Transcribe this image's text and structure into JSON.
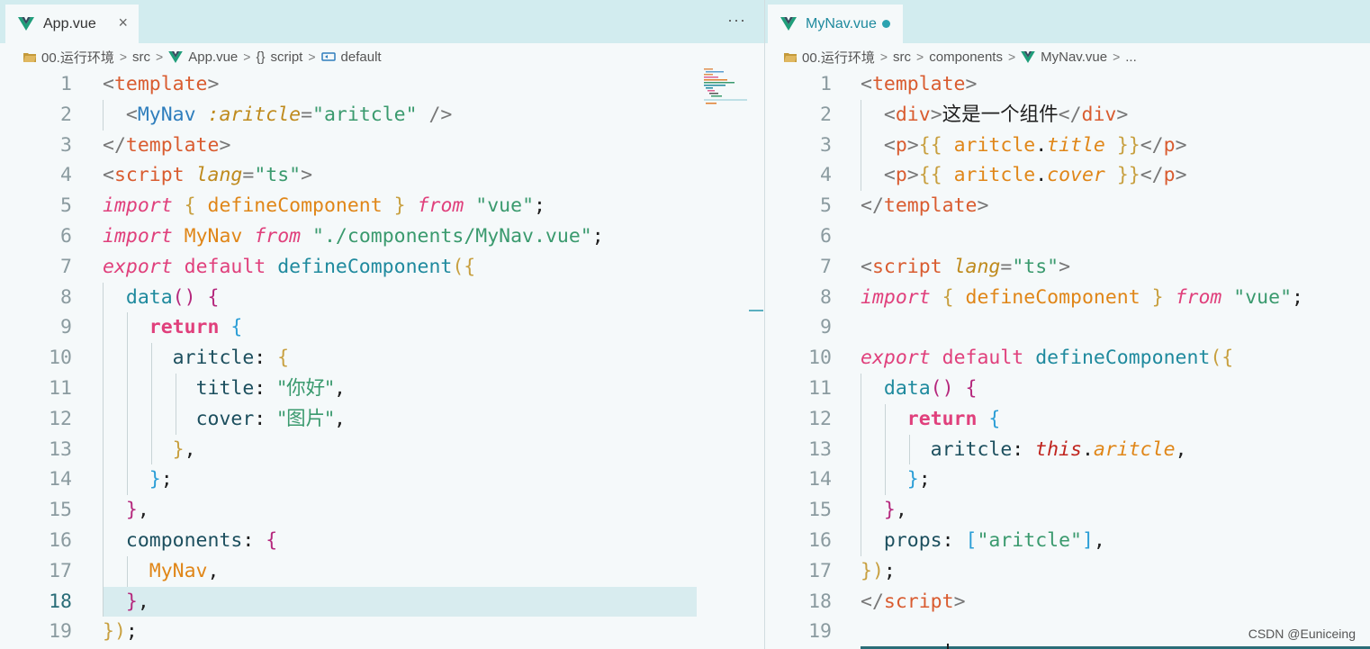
{
  "left": {
    "tab": {
      "name": "App.vue",
      "close": "×",
      "more": "···"
    },
    "breadcrumb": [
      "00.运行环境",
      "src",
      "App.vue",
      "script",
      "default"
    ],
    "line_numbers": [
      "1",
      "2",
      "3",
      "4",
      "5",
      "6",
      "7",
      "8",
      "9",
      "10",
      "11",
      "12",
      "13",
      "14",
      "15",
      "16",
      "17",
      "18",
      "19"
    ],
    "current_line": "18"
  },
  "right": {
    "tab": {
      "name": "MyNav.vue"
    },
    "breadcrumb": [
      "00.运行环境",
      "src",
      "components",
      "MyNav.vue",
      "..."
    ],
    "line_numbers": [
      "1",
      "2",
      "3",
      "4",
      "5",
      "6",
      "7",
      "8",
      "9",
      "10",
      "11",
      "12",
      "13",
      "14",
      "15",
      "16",
      "17",
      "18",
      "19"
    ]
  },
  "code_left": [
    [
      [
        "pu",
        "<"
      ],
      [
        "tg",
        "template"
      ],
      [
        "pu",
        ">"
      ]
    ],
    [
      [
        "pu",
        "  <"
      ],
      [
        "cm",
        "MyNav"
      ],
      [
        "bk",
        " "
      ],
      [
        "at",
        ":aritcle"
      ],
      [
        "pu",
        "="
      ],
      [
        "st",
        "\"aritcle\""
      ],
      [
        "pu",
        " />"
      ]
    ],
    [
      [
        "pu",
        "</"
      ],
      [
        "tg",
        "template"
      ],
      [
        "pu",
        ">"
      ]
    ],
    [
      [
        "pu",
        "<"
      ],
      [
        "tg",
        "script"
      ],
      [
        "bk",
        " "
      ],
      [
        "at",
        "lang"
      ],
      [
        "pu",
        "="
      ],
      [
        "st",
        "\"ts\""
      ],
      [
        "pu",
        ">"
      ]
    ],
    [
      [
        "kw",
        "import"
      ],
      [
        "bk",
        " "
      ],
      [
        "br1",
        "{"
      ],
      [
        "bk",
        " "
      ],
      [
        "cl",
        "defineComponent"
      ],
      [
        "bk",
        " "
      ],
      [
        "br1",
        "}"
      ],
      [
        "bk",
        " "
      ],
      [
        "kw",
        "from"
      ],
      [
        "bk",
        " "
      ],
      [
        "st",
        "\"vue\""
      ],
      [
        "bk",
        ";"
      ]
    ],
    [
      [
        "kw",
        "import"
      ],
      [
        "bk",
        " "
      ],
      [
        "cl",
        "MyNav"
      ],
      [
        "bk",
        " "
      ],
      [
        "kw",
        "from"
      ],
      [
        "bk",
        " "
      ],
      [
        "st",
        "\"./components/MyNav.vue\""
      ],
      [
        "bk",
        ";"
      ]
    ],
    [
      [
        "kw",
        "export"
      ],
      [
        "bk",
        " "
      ],
      [
        "ke",
        "default"
      ],
      [
        "bk",
        " "
      ],
      [
        "fn",
        "defineComponent"
      ],
      [
        "br1",
        "({"
      ]
    ],
    [
      [
        "bk",
        "  "
      ],
      [
        "fn",
        "data"
      ],
      [
        "br2",
        "()"
      ],
      [
        "bk",
        " "
      ],
      [
        "br2",
        "{"
      ]
    ],
    [
      [
        "bk",
        "    "
      ],
      [
        "kb",
        "return"
      ],
      [
        "bk",
        " "
      ],
      [
        "br3",
        "{"
      ]
    ],
    [
      [
        "bk",
        "      "
      ],
      [
        "id",
        "aritcle"
      ],
      [
        "bk",
        ": "
      ],
      [
        "br1",
        "{"
      ]
    ],
    [
      [
        "bk",
        "        "
      ],
      [
        "id",
        "title"
      ],
      [
        "bk",
        ": "
      ],
      [
        "st",
        "\"你好\""
      ],
      [
        "bk",
        ","
      ]
    ],
    [
      [
        "bk",
        "        "
      ],
      [
        "id",
        "cover"
      ],
      [
        "bk",
        ": "
      ],
      [
        "st",
        "\"图片\""
      ],
      [
        "bk",
        ","
      ]
    ],
    [
      [
        "bk",
        "      "
      ],
      [
        "br1",
        "}"
      ],
      [
        "bk",
        ","
      ]
    ],
    [
      [
        "bk",
        "    "
      ],
      [
        "br3",
        "}"
      ],
      [
        "bk",
        ";"
      ]
    ],
    [
      [
        "bk",
        "  "
      ],
      [
        "br2",
        "}"
      ],
      [
        "bk",
        ","
      ]
    ],
    [
      [
        "bk",
        "  "
      ],
      [
        "id",
        "components"
      ],
      [
        "bk",
        ": "
      ],
      [
        "br2",
        "{"
      ]
    ],
    [
      [
        "bk",
        "    "
      ],
      [
        "cl",
        "MyNav"
      ],
      [
        "bk",
        ","
      ]
    ],
    [
      [
        "bk",
        "  "
      ],
      [
        "br2",
        "}"
      ],
      [
        "bk",
        ","
      ]
    ],
    [
      [
        "br1",
        "})"
      ],
      [
        "bk",
        ";"
      ]
    ]
  ],
  "code_right": [
    [
      [
        "pu",
        "<"
      ],
      [
        "tg",
        "template"
      ],
      [
        "pu",
        ">"
      ]
    ],
    [
      [
        "pu",
        "  <"
      ],
      [
        "tg",
        "div"
      ],
      [
        "pu",
        ">"
      ],
      [
        "bk",
        "这是一个组件"
      ],
      [
        "pu",
        "</"
      ],
      [
        "tg",
        "div"
      ],
      [
        "pu",
        ">"
      ]
    ],
    [
      [
        "pu",
        "  <"
      ],
      [
        "tg",
        "p"
      ],
      [
        "pu",
        ">"
      ],
      [
        "br1",
        "{{"
      ],
      [
        "bk",
        " "
      ],
      [
        "cl",
        "aritcle"
      ],
      [
        "bk",
        "."
      ],
      [
        "pr",
        "title"
      ],
      [
        "bk",
        " "
      ],
      [
        "br1",
        "}}"
      ],
      [
        "pu",
        "</"
      ],
      [
        "tg",
        "p"
      ],
      [
        "pu",
        ">"
      ]
    ],
    [
      [
        "pu",
        "  <"
      ],
      [
        "tg",
        "p"
      ],
      [
        "pu",
        ">"
      ],
      [
        "br1",
        "{{"
      ],
      [
        "bk",
        " "
      ],
      [
        "cl",
        "aritcle"
      ],
      [
        "bk",
        "."
      ],
      [
        "pr",
        "cover"
      ],
      [
        "bk",
        " "
      ],
      [
        "br1",
        "}}"
      ],
      [
        "pu",
        "</"
      ],
      [
        "tg",
        "p"
      ],
      [
        "pu",
        ">"
      ]
    ],
    [
      [
        "pu",
        "</"
      ],
      [
        "tg",
        "template"
      ],
      [
        "pu",
        ">"
      ]
    ],
    [],
    [
      [
        "pu",
        "<"
      ],
      [
        "tg",
        "script"
      ],
      [
        "bk",
        " "
      ],
      [
        "at",
        "lang"
      ],
      [
        "pu",
        "="
      ],
      [
        "st",
        "\"ts\""
      ],
      [
        "pu",
        ">"
      ]
    ],
    [
      [
        "kw",
        "import"
      ],
      [
        "bk",
        " "
      ],
      [
        "br1",
        "{"
      ],
      [
        "bk",
        " "
      ],
      [
        "cl",
        "defineComponent"
      ],
      [
        "bk",
        " "
      ],
      [
        "br1",
        "}"
      ],
      [
        "bk",
        " "
      ],
      [
        "kw",
        "from"
      ],
      [
        "bk",
        " "
      ],
      [
        "st",
        "\"vue\""
      ],
      [
        "bk",
        ";"
      ]
    ],
    [],
    [
      [
        "kw",
        "export"
      ],
      [
        "bk",
        " "
      ],
      [
        "ke",
        "default"
      ],
      [
        "bk",
        " "
      ],
      [
        "fn",
        "defineComponent"
      ],
      [
        "br1",
        "({"
      ]
    ],
    [
      [
        "bk",
        "  "
      ],
      [
        "fn",
        "data"
      ],
      [
        "br2",
        "()"
      ],
      [
        "bk",
        " "
      ],
      [
        "br2",
        "{"
      ]
    ],
    [
      [
        "bk",
        "    "
      ],
      [
        "kb",
        "return"
      ],
      [
        "bk",
        " "
      ],
      [
        "br3",
        "{"
      ]
    ],
    [
      [
        "bk",
        "      "
      ],
      [
        "id",
        "aritcle"
      ],
      [
        "bk",
        ": "
      ],
      [
        "th",
        "this"
      ],
      [
        "bk",
        "."
      ],
      [
        "pr",
        "aritcle"
      ],
      [
        "bk",
        ","
      ]
    ],
    [
      [
        "bk",
        "    "
      ],
      [
        "br3",
        "}"
      ],
      [
        "bk",
        ";"
      ]
    ],
    [
      [
        "bk",
        "  "
      ],
      [
        "br2",
        "}"
      ],
      [
        "bk",
        ","
      ]
    ],
    [
      [
        "bk",
        "  "
      ],
      [
        "id",
        "props"
      ],
      [
        "bk",
        ": "
      ],
      [
        "br3",
        "["
      ],
      [
        "st",
        "\"aritcle\""
      ],
      [
        "br3",
        "]"
      ],
      [
        "bk",
        ","
      ]
    ],
    [
      [
        "br1",
        "})"
      ],
      [
        "bk",
        ";"
      ]
    ],
    [
      [
        "pu",
        "</"
      ],
      [
        "tg",
        "script"
      ],
      [
        "pu",
        ">"
      ]
    ],
    []
  ],
  "watermark": "CSDN @Euniceing",
  "colors": {
    "accent": "#2ba3b0",
    "vue_green": "#41b883",
    "vue_dark": "#35495e"
  }
}
